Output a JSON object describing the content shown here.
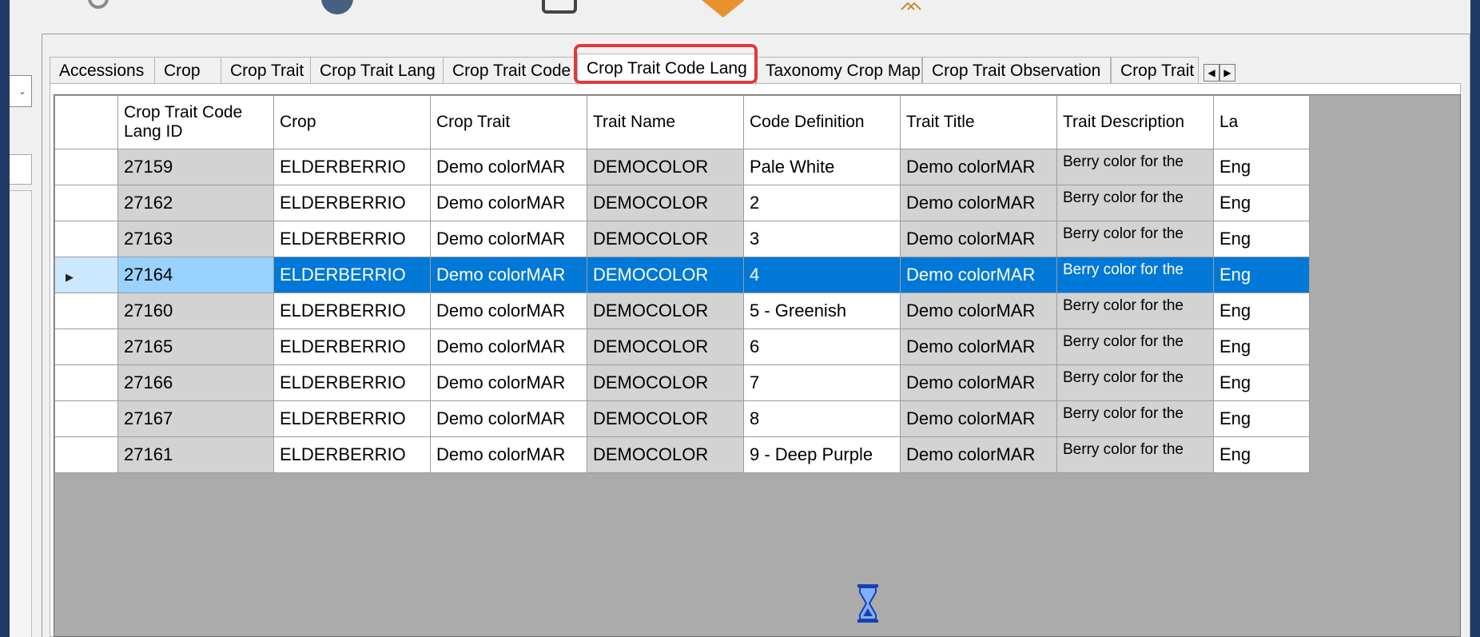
{
  "tabs": [
    "Accessions",
    "Crop",
    "Crop Trait",
    "Crop Trait Lang",
    "Crop Trait Code",
    "Crop Trait Code Lang",
    "Taxonomy Crop Map",
    "Crop Trait Observation",
    "Crop Trait"
  ],
  "active_tab": "Crop Trait Code Lang",
  "columns": [
    "Crop Trait Code Lang ID",
    "Crop",
    "Crop Trait",
    "Trait Name",
    "Code Definition",
    "Trait Title",
    "Trait Description",
    "La"
  ],
  "rows": [
    {
      "id": "27159",
      "crop": "ELDERBERRIO",
      "trait": "Demo colorMAR",
      "name": "DEMOCOLOR",
      "code_def": "Pale White",
      "title": "Demo colorMAR",
      "desc": "Berry color for the",
      "lang": "Eng"
    },
    {
      "id": "27162",
      "crop": "ELDERBERRIO",
      "trait": "Demo colorMAR",
      "name": "DEMOCOLOR",
      "code_def": "2",
      "title": "Demo colorMAR",
      "desc": "Berry color for the",
      "lang": "Eng"
    },
    {
      "id": "27163",
      "crop": "ELDERBERRIO",
      "trait": "Demo colorMAR",
      "name": "DEMOCOLOR",
      "code_def": "3",
      "title": "Demo colorMAR",
      "desc": "Berry color for the",
      "lang": "Eng"
    },
    {
      "id": "27164",
      "crop": "ELDERBERRIO",
      "trait": "Demo colorMAR",
      "name": "DEMOCOLOR",
      "code_def": "4",
      "title": "Demo colorMAR",
      "desc": "Berry color for the",
      "lang": "Eng"
    },
    {
      "id": "27160",
      "crop": "ELDERBERRIO",
      "trait": "Demo colorMAR",
      "name": "DEMOCOLOR",
      "code_def": "5 - Greenish",
      "title": "Demo colorMAR",
      "desc": "Berry color for the",
      "lang": "Eng"
    },
    {
      "id": "27165",
      "crop": "ELDERBERRIO",
      "trait": "Demo colorMAR",
      "name": "DEMOCOLOR",
      "code_def": "6",
      "title": "Demo colorMAR",
      "desc": "Berry color for the",
      "lang": "Eng"
    },
    {
      "id": "27166",
      "crop": "ELDERBERRIO",
      "trait": "Demo colorMAR",
      "name": "DEMOCOLOR",
      "code_def": "7",
      "title": "Demo colorMAR",
      "desc": "Berry color for the",
      "lang": "Eng"
    },
    {
      "id": "27167",
      "crop": "ELDERBERRIO",
      "trait": "Demo colorMAR",
      "name": "DEMOCOLOR",
      "code_def": "8",
      "title": "Demo colorMAR",
      "desc": "Berry color for the",
      "lang": "Eng"
    },
    {
      "id": "27161",
      "crop": "ELDERBERRIO",
      "trait": "Demo colorMAR",
      "name": "DEMOCOLOR",
      "code_def": "9 - Deep Purple",
      "title": "Demo colorMAR",
      "desc": "Berry color for the",
      "lang": "Eng"
    }
  ],
  "selected_row_index": 3,
  "icons": {
    "row_indicator": "row-selector-arrow-icon",
    "busy": "hourglass-icon",
    "scroll_left": "scroll-left-icon",
    "scroll_right": "scroll-right-icon"
  },
  "colors": {
    "selection": "#0078d7",
    "selected_id_cell": "#99d1ff",
    "readonly_cell": "#d3d3d3",
    "tab_highlight": "#e0393e",
    "frame_background": "#1f3a66"
  }
}
